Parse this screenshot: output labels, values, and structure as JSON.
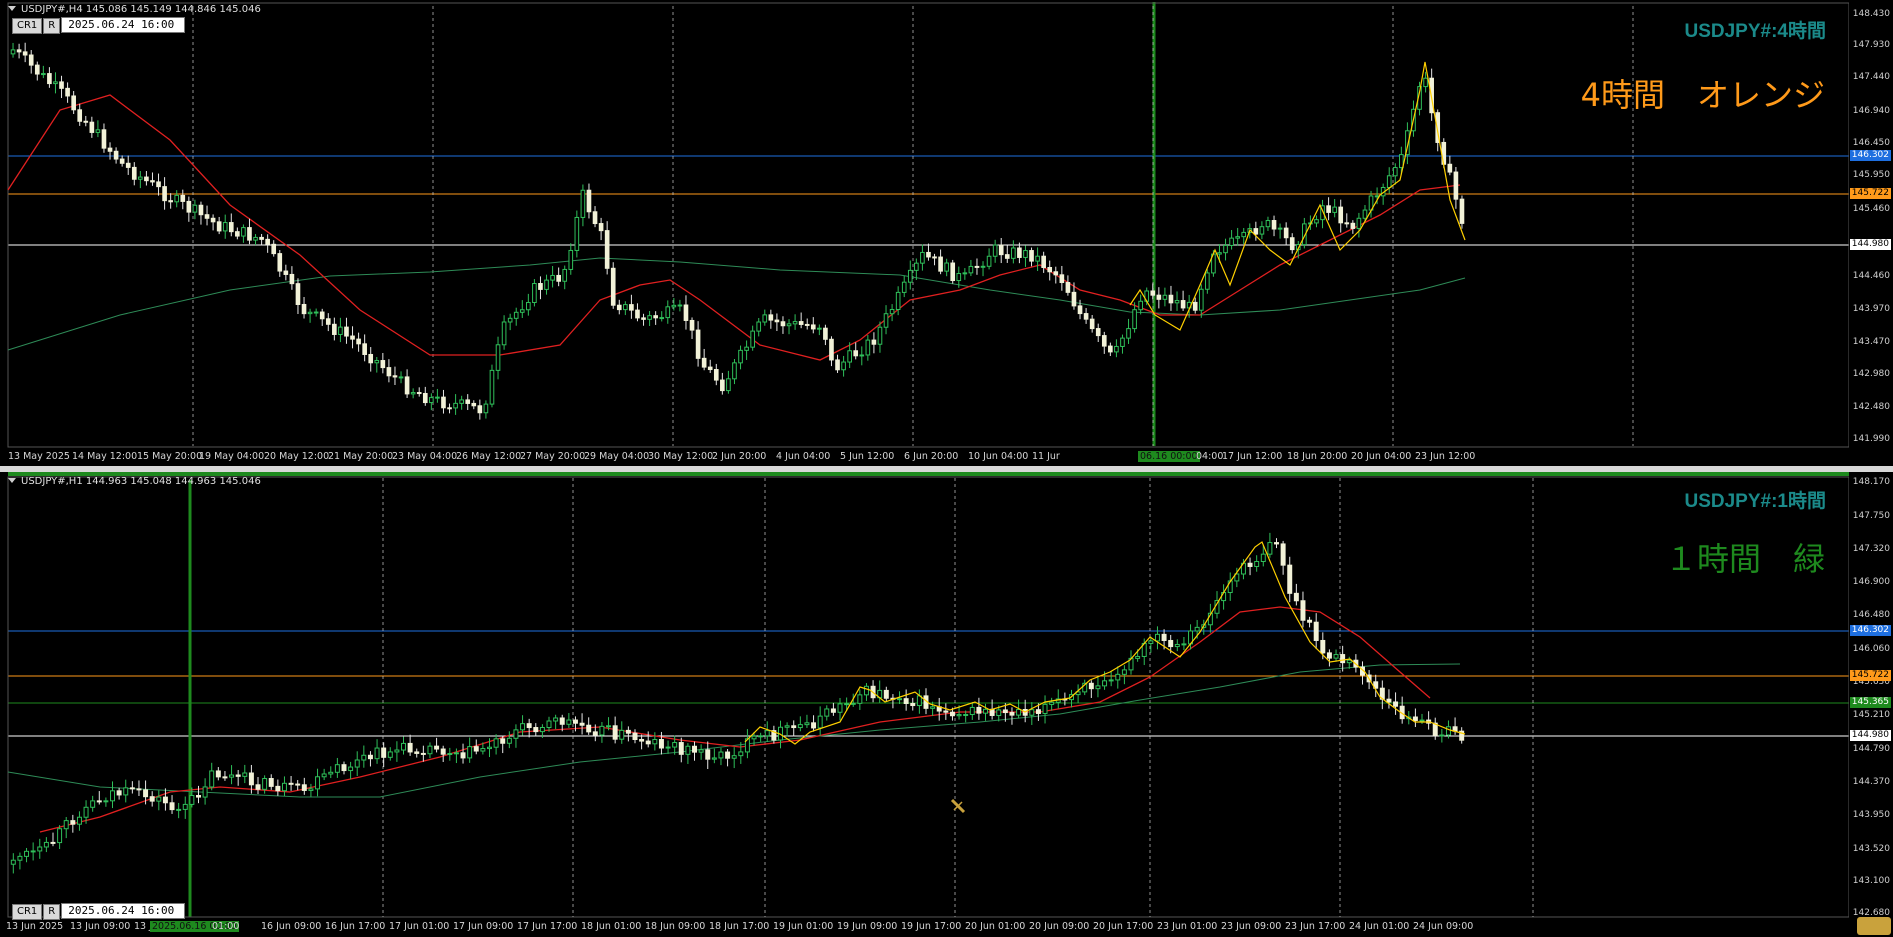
{
  "top": {
    "header": "USDJPY#,H4  145.086 145.149 144.846 145.046",
    "btn1": "CR1",
    "btn2": "R",
    "date_box": "2025.06.24 16:00",
    "title": "USDJPY#:4時間",
    "label": "4時間　オレンジ",
    "label_color": "#ff9a1a",
    "price_ticks": [
      "148.430",
      "147.930",
      "147.440",
      "146.940",
      "146.450",
      "145.950",
      "145.460",
      "144.460",
      "143.970",
      "143.470",
      "142.980",
      "142.480",
      "141.990"
    ],
    "badges": [
      {
        "text": "146.302",
        "bg": "#1e6fe0",
        "fg": "#ffffff"
      },
      {
        "text": "145.722",
        "bg": "#ff9a1a",
        "fg": "#000000"
      },
      {
        "text": "144.980",
        "bg": "#ffffff",
        "fg": "#000000"
      }
    ],
    "x_labels": [
      "13 May 2025",
      "14 May 12:00",
      "15 May 20:00",
      "19 May 04:00",
      "20 May 12:00",
      "21 May 20:00",
      "23 May 04:00",
      "26 May 12:00",
      "27 May 20:00",
      "29 May 04:00",
      "30 May 12:00",
      "2 Jun 20:00",
      "4 Jun 04:00",
      "5 Jun 12:00",
      "6 Jun 20:00",
      "10 Jun 04:00",
      "11 Jur",
      "06.16 00:00",
      "04:00",
      "17 Jun 12:00",
      "18 Jun 20:00",
      "20 Jun 04:00",
      "23 Jun 12:00"
    ]
  },
  "bottom": {
    "header": "USDJPY#,H1  144.963 145.048 144.963 145.046",
    "btn1": "CR1",
    "btn2": "R",
    "date_box": "2025.06.24  16:00",
    "title": "USDJPY#:1時間",
    "label": "１時間　緑",
    "label_color": "#1e8a1e",
    "price_ticks": [
      "148.170",
      "147.750",
      "147.320",
      "146.900",
      "146.480",
      "146.060",
      "145.630",
      "145.210",
      "144.790",
      "144.370",
      "143.950",
      "143.520",
      "143.100",
      "142.680"
    ],
    "badges": [
      {
        "text": "146.302",
        "bg": "#1e6fe0",
        "fg": "#ffffff"
      },
      {
        "text": "145.722",
        "bg": "#ff9a1a",
        "fg": "#000000"
      },
      {
        "text": "145.365",
        "bg": "#1e8a1e",
        "fg": "#ffffff"
      },
      {
        "text": "144.980",
        "bg": "#ffffff",
        "fg": "#000000"
      }
    ],
    "x_labels": [
      "13 Jun 2025",
      "13 Jun 09:00",
      "13 J",
      "2025.06.16 00:00",
      "01:00",
      "16 Jun 09:00",
      "16 Jun 17:00",
      "17 Jun 01:00",
      "17 Jun 09:00",
      "17 Jun 17:00",
      "18 Jun 01:00",
      "18 Jun 09:00",
      "18 Jun 17:00",
      "19 Jun 01:00",
      "19 Jun 09:00",
      "19 Jun 17:00",
      "20 Jun 01:00",
      "20 Jun 09:00",
      "20 Jun 17:00",
      "23 Jun 01:00",
      "23 Jun 09:00",
      "23 Jun 17:00",
      "24 Jun 01:00",
      "24 Jun 09:00"
    ]
  }
}
